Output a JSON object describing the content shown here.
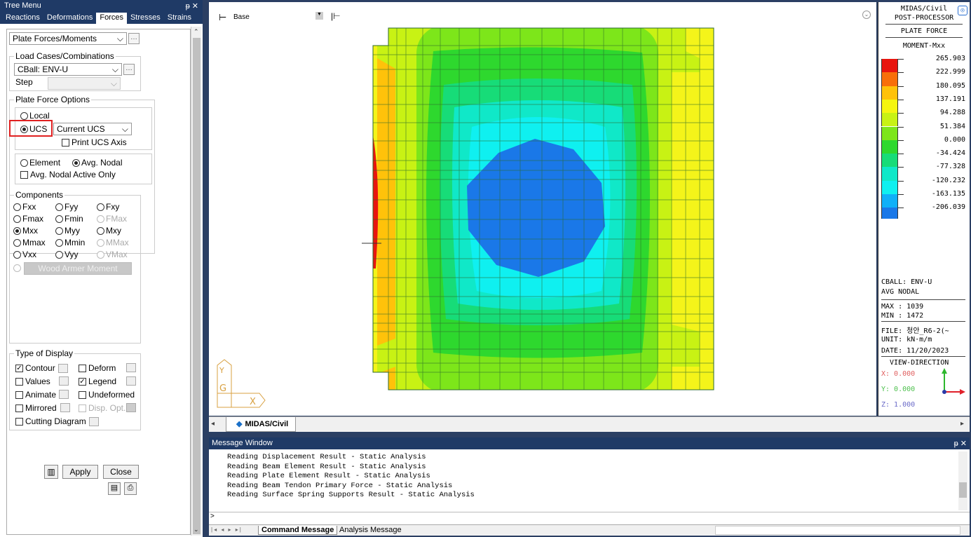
{
  "tree": {
    "title": "Tree Menu",
    "pin": "ᵽ ✕",
    "tabs": [
      "Reactions",
      "Deformations",
      "Forces",
      "Stresses",
      "Strains"
    ],
    "active_tab": "Forces"
  },
  "panel": {
    "function": "Plate Forces/Moments",
    "load_cases_label": "Load Cases/Combinations",
    "load_case": "CBall: ENV-U",
    "step_label": "Step",
    "options_label": "Plate Force Options",
    "local": "Local",
    "ucs": "UCS",
    "current_ucs": "Current UCS",
    "print_ucs": "Print UCS Axis",
    "element": "Element",
    "avg_nodal": "Avg. Nodal",
    "avg_nodal_active": "Avg. Nodal Active Only",
    "components_label": "Components",
    "components": [
      [
        "Fxx",
        "Fyy",
        "Fxy"
      ],
      [
        "Fmax",
        "Fmin",
        "FMax"
      ],
      [
        "Mxx",
        "Myy",
        "Mxy"
      ],
      [
        "Mmax",
        "Mmin",
        "MMax"
      ],
      [
        "Vxx",
        "Vyy",
        "VMax"
      ]
    ],
    "wood_armer": "Wood Armer Moment",
    "display_label": "Type of Display",
    "contour": "Contour",
    "deform": "Deform",
    "values": "Values",
    "legend": "Legend",
    "animate": "Animate",
    "undeformed": "Undeformed",
    "mirrored": "Mirrored",
    "disp_opt": "Disp. Opt.",
    "cutting": "Cutting Diagram",
    "apply": "Apply",
    "close": "Close"
  },
  "view": {
    "base": "Base",
    "tab": "MIDAS/Civil"
  },
  "legend": {
    "header1": "MIDAS/Civil",
    "header2": "POST-PROCESSOR",
    "title": "PLATE FORCE",
    "subtitle": "MOMENT-Mxx",
    "values": [
      "265.903",
      "222.999",
      "180.095",
      "137.191",
      "94.288",
      "51.384",
      "0.000",
      "-34.424",
      "-77.328",
      "-120.232",
      "-163.135",
      "-206.039"
    ],
    "colors": [
      "#e8150f",
      "#f86f0a",
      "#ffc20a",
      "#f5f510",
      "#c8f214",
      "#7de61a",
      "#2ed82e",
      "#17dc78",
      "#10e8c8",
      "#0ff0f0",
      "#10b0f8",
      "#1a78e8"
    ],
    "case": "CBALL: ENV-U",
    "avg": "AVG NODAL",
    "max": "MAX : 1039",
    "min": "MIN : 1472",
    "file": "FILE: 청안_R6-2(~",
    "unit": "UNIT: kN·m/m",
    "date": "DATE: 11/20/2023",
    "view_dir": "VIEW-DIRECTION",
    "x": "X: 0.000",
    "y": "Y: 0.000",
    "z": "Z: 1.000"
  },
  "messages": {
    "title": "Message Window",
    "pin": "ᵽ ✕",
    "lines": [
      "Reading Displacement Result - Static Analysis",
      "Reading Beam Element Result - Static Analysis",
      "Reading Plate Element Result - Static Analysis",
      "Reading Beam Tendon Primary Force - Static Analysis",
      "Reading Surface Spring Supports Result - Static Analysis"
    ],
    "tab1": "Command Message",
    "tab2": "Analysis Message"
  }
}
